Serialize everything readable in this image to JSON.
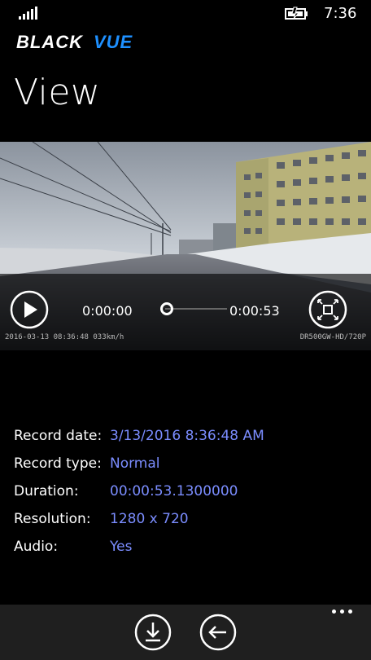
{
  "status": {
    "time": "7:36",
    "signal_icon": "signal-bars-icon",
    "battery_icon": "battery-charging-icon"
  },
  "brand": {
    "logo_text": "BLACKVUE",
    "logo_color": "#1e90ff"
  },
  "page": {
    "title": "View"
  },
  "player": {
    "current_time": "0:00:00",
    "total_time": "0:00:53",
    "progress": 0,
    "play_icon": "play-icon",
    "fullscreen_icon": "fullscreen-icon",
    "stamp_left": "2016-03-13 08:36:48  033km/h",
    "stamp_right": "DR500GW-HD/720P"
  },
  "details": [
    {
      "label": "Record date:",
      "value": "3/13/2016 8:36:48 AM"
    },
    {
      "label": "Record type:",
      "value": "Normal"
    },
    {
      "label": "Duration:",
      "value": "00:00:53.1300000"
    },
    {
      "label": "Resolution:",
      "value": "1280 x 720"
    },
    {
      "label": "Audio:",
      "value": "Yes"
    }
  ],
  "colors": {
    "accent": "#7b8dff",
    "appbar": "#1f1f1f"
  },
  "appbar": {
    "download_icon": "download-icon",
    "back_icon": "back-arrow-icon",
    "more_icon": "more-dots-icon"
  }
}
